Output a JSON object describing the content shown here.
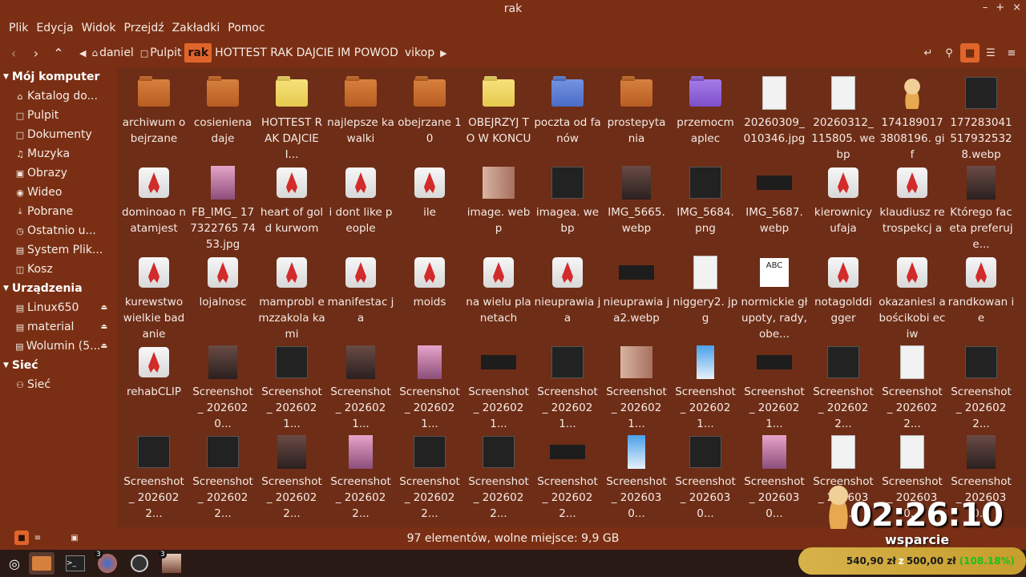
{
  "window": {
    "title": "rak",
    "controls": [
      "–",
      "+",
      "×"
    ]
  },
  "menu": [
    "Plik",
    "Edycja",
    "Widok",
    "Przejdź",
    "Zakładki",
    "Pomoc"
  ],
  "breadcrumb": [
    "daniel",
    "Pulpit",
    "rak",
    "HOTTEST RAK DAJCIE IM POWOD",
    "vikop"
  ],
  "sidebar": {
    "sections": [
      {
        "title": "Mój komputer",
        "items": [
          "Katalog do...",
          "Pulpit",
          "Dokumenty",
          "Muzyka",
          "Obrazy",
          "Wideo",
          "Pobrane",
          "Ostatnio u...",
          "System Plik...",
          "Kosz"
        ]
      },
      {
        "title": "Urządzenia",
        "items": [
          "Linux650",
          "material",
          "Wolumin (5..."
        ]
      },
      {
        "title": "Sieć",
        "items": [
          "Sieć"
        ]
      }
    ]
  },
  "files": [
    {
      "name": "archiwum obejrzane",
      "kind": "folder-orange"
    },
    {
      "name": "cosieniena daje",
      "kind": "folder-orange"
    },
    {
      "name": "HOTTEST RAK DAJCIE I...",
      "kind": "folder-yellow"
    },
    {
      "name": "najlepsze kawalki",
      "kind": "folder-orange"
    },
    {
      "name": "obejrzane 10",
      "kind": "folder-orange"
    },
    {
      "name": "OBEJRZYJ TO W KONCU",
      "kind": "folder-yellow"
    },
    {
      "name": "poczta od fanów",
      "kind": "folder-blue"
    },
    {
      "name": "prostepyta nia",
      "kind": "folder-orange"
    },
    {
      "name": "przemocm aplec",
      "kind": "folder-purple"
    },
    {
      "name": "20260309_ 010346.jpg",
      "kind": "img-light"
    },
    {
      "name": "20260312_ 115805. webp",
      "kind": "img-light"
    },
    {
      "name": "174189017 3808196. gif",
      "kind": "img-gif"
    },
    {
      "name": "177283041 517932532 8.webp",
      "kind": "img-dark"
    },
    {
      "name": "dominoao natamjest",
      "kind": "app"
    },
    {
      "name": "FB_IMG_ 177322765 7453.jpg",
      "kind": "img-pink"
    },
    {
      "name": "heart of gold kurwom",
      "kind": "app"
    },
    {
      "name": "i dont like people",
      "kind": "app"
    },
    {
      "name": "ile",
      "kind": "app"
    },
    {
      "name": "image. webp",
      "kind": "img-face2"
    },
    {
      "name": "imagea. webp",
      "kind": "img-dark"
    },
    {
      "name": "IMG_5665. webp",
      "kind": "img-photo"
    },
    {
      "name": "IMG_5684. png",
      "kind": "img-dark"
    },
    {
      "name": "IMG_5687. webp",
      "kind": "img-wide"
    },
    {
      "name": "kierownicy ufaja",
      "kind": "app"
    },
    {
      "name": "klaudiusz retrospekcj a",
      "kind": "app"
    },
    {
      "name": "Którego faceta preferuje...",
      "kind": "img-photo"
    },
    {
      "name": "kurewstwo wielkie badanie",
      "kind": "app"
    },
    {
      "name": "lojalnosc",
      "kind": "app"
    },
    {
      "name": "mamprobl emzzakola kami",
      "kind": "app"
    },
    {
      "name": "manifestac ja",
      "kind": "app"
    },
    {
      "name": "moids",
      "kind": "app"
    },
    {
      "name": "na wielu planetach",
      "kind": "app"
    },
    {
      "name": "nieuprawia ja",
      "kind": "app"
    },
    {
      "name": "nieuprawia ja2.webp",
      "kind": "img-wide"
    },
    {
      "name": "niggery2. jpg",
      "kind": "img-light"
    },
    {
      "name": "normickie głupoty, rady, obe...",
      "kind": "img-abc"
    },
    {
      "name": "notagolddi gger",
      "kind": "app"
    },
    {
      "name": "okazaniesl abościkobi eciw",
      "kind": "app"
    },
    {
      "name": "randkowan ie",
      "kind": "app"
    },
    {
      "name": "rehabCLIP",
      "kind": "app"
    },
    {
      "name": "Screenshot _ 2026020...",
      "kind": "img-photo"
    },
    {
      "name": "Screenshot _ 2026021...",
      "kind": "img-dark"
    },
    {
      "name": "Screenshot _ 2026021...",
      "kind": "img-photo"
    },
    {
      "name": "Screenshot _ 2026021...",
      "kind": "img-pink"
    },
    {
      "name": "Screenshot _ 2026021...",
      "kind": "img-wide"
    },
    {
      "name": "Screenshot _ 2026021...",
      "kind": "img-dark"
    },
    {
      "name": "Screenshot _ 2026021...",
      "kind": "img-face2"
    },
    {
      "name": "Screenshot _ 2026021...",
      "kind": "img-blue"
    },
    {
      "name": "Screenshot _ 2026021...",
      "kind": "img-wide"
    },
    {
      "name": "Screenshot _ 2026022...",
      "kind": "img-dark"
    },
    {
      "name": "Screenshot _ 2026022...",
      "kind": "img-light"
    },
    {
      "name": "Screenshot _ 2026022...",
      "kind": "img-dark"
    },
    {
      "name": "Screenshot _ 2026022...",
      "kind": "img-dark"
    },
    {
      "name": "Screenshot _ 2026022...",
      "kind": "img-dark"
    },
    {
      "name": "Screenshot _ 2026022...",
      "kind": "img-photo"
    },
    {
      "name": "Screenshot _ 2026022...",
      "kind": "img-pink"
    },
    {
      "name": "Screenshot _ 2026022...",
      "kind": "img-dark"
    },
    {
      "name": "Screenshot _ 2026022...",
      "kind": "img-dark"
    },
    {
      "name": "Screenshot _ 2026022...",
      "kind": "img-wide"
    },
    {
      "name": "Screenshot _ 2026030...",
      "kind": "img-blue"
    },
    {
      "name": "Screenshot _ 2026030...",
      "kind": "img-dark"
    },
    {
      "name": "Screenshot _ 2026030...",
      "kind": "img-pink"
    },
    {
      "name": "Screenshot _ 2026030...",
      "kind": "img-light"
    },
    {
      "name": "Screenshot _ 2026030...",
      "kind": "img-light"
    },
    {
      "name": "Screenshot _ 2026030...",
      "kind": "img-photo"
    }
  ],
  "status": {
    "text": "97 elementów, wolne miejsce: 9,9 GB"
  },
  "taskbar": {
    "badges": [
      "3",
      "3"
    ]
  },
  "overlay": {
    "clock": "02:26:10",
    "support": "wsparcie",
    "donated": "540,90 zł",
    "connector": "z",
    "goal": "500,00 zł",
    "percent": "(108.18%)"
  },
  "colors": {
    "chrome": "#7a2f14",
    "content_bg": "#6e2d17",
    "accent": "#e0652a"
  }
}
